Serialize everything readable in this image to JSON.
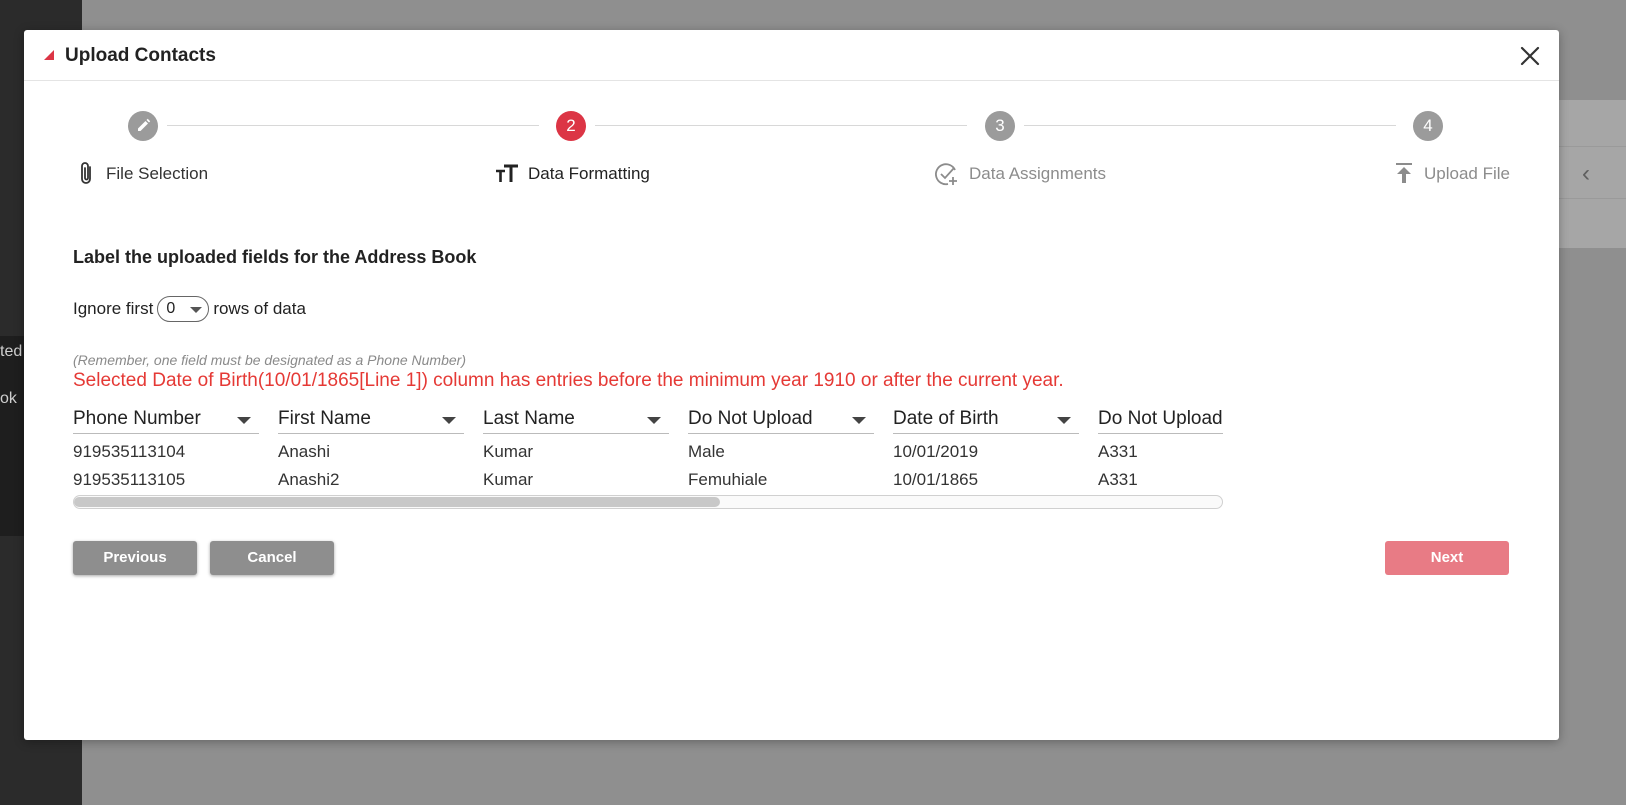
{
  "background": {
    "left_peek": [
      "ted",
      "ok"
    ]
  },
  "modal": {
    "title": "Upload Contacts",
    "steps": [
      {
        "label": "File Selection",
        "badge": "",
        "state": "done",
        "icon": "paperclip-icon"
      },
      {
        "label": "Data Formatting",
        "badge": "2",
        "state": "active",
        "icon": "text-format-icon"
      },
      {
        "label": "Data Assignments",
        "badge": "3",
        "state": "pending",
        "icon": "check-add-icon"
      },
      {
        "label": "Upload File",
        "badge": "4",
        "state": "pending",
        "icon": "upload-icon"
      }
    ],
    "section_title": "Label the uploaded fields for the Address Book",
    "ignore": {
      "prefix": "Ignore first",
      "value": "0",
      "suffix": "rows of data"
    },
    "hint": "(Remember, one field must be designated as a Phone Number)",
    "error": "Selected Date of Birth(10/01/1865[Line 1]) column has entries before the minimum year 1910 or after the current year.",
    "columns": [
      {
        "header": "Phone Number",
        "cells": [
          "919535113104",
          "919535113105"
        ]
      },
      {
        "header": "First Name",
        "cells": [
          "Anashi",
          "Anashi2"
        ]
      },
      {
        "header": "Last Name",
        "cells": [
          "Kumar",
          "Kumar"
        ]
      },
      {
        "header": "Do Not Upload",
        "cells": [
          "Male",
          "Femuhiale"
        ]
      },
      {
        "header": "Date of Birth",
        "cells": [
          "10/01/2019",
          "10/01/1865"
        ]
      },
      {
        "header": "Do Not Upload",
        "cells": [
          "A331",
          "A331"
        ]
      }
    ],
    "buttons": {
      "previous": "Previous",
      "cancel": "Cancel",
      "next": "Next"
    },
    "colors": {
      "accent": "#dc3545",
      "error": "#e53935",
      "next_disabled": "#e87b85",
      "grey_button": "#8e8e8e"
    }
  }
}
